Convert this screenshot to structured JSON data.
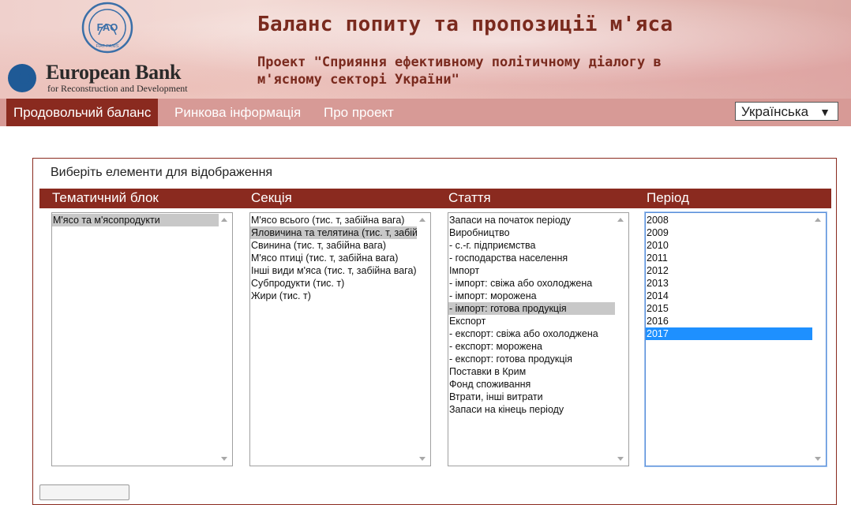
{
  "header": {
    "fao_logo_text": "FAO",
    "fao_motto": "FIAT PANIS",
    "ebrd_name": "European Bank",
    "ebrd_subtitle": "for Reconstruction and Development",
    "title": "Баланс попиту та пропозиції м'яса",
    "subtitle": "Проект \"Сприяння ефективному політичному діалогу в м'ясному секторі України\""
  },
  "nav": {
    "items": [
      {
        "label": "Продовольчий баланс",
        "active": true
      },
      {
        "label": "Ринкова інформація",
        "active": false
      },
      {
        "label": "Про проект",
        "active": false
      }
    ],
    "language": {
      "selected": "Українська",
      "arrow": "▼"
    }
  },
  "panel": {
    "title": "Виберіть елементи для відображення",
    "columns": [
      {
        "header": "Тематичний блок",
        "options": [
          {
            "label": "М'ясо та м'ясопродукти",
            "state": "gray"
          }
        ]
      },
      {
        "header": "Секція",
        "options": [
          {
            "label": "М'ясо всього (тис. т, забійна вага)",
            "state": "none"
          },
          {
            "label": "Яловичина та телятина (тис. т, забійна вага)",
            "state": "gray"
          },
          {
            "label": "Свинина (тис. т, забійна вага)",
            "state": "none"
          },
          {
            "label": "М'ясо птиці (тис. т, забійна вага)",
            "state": "none"
          },
          {
            "label": "Інші види м'яса (тис. т, забійна вага)",
            "state": "none"
          },
          {
            "label": "Субпродукти (тис. т)",
            "state": "none"
          },
          {
            "label": "Жири (тис. т)",
            "state": "none"
          }
        ]
      },
      {
        "header": "Стаття",
        "options": [
          {
            "label": "Запаси на початок періоду",
            "state": "none"
          },
          {
            "label": "Виробництво",
            "state": "none"
          },
          {
            "label": "- с.-г. підприємства",
            "state": "none"
          },
          {
            "label": "- господарства населення",
            "state": "none"
          },
          {
            "label": "Імпорт",
            "state": "none"
          },
          {
            "label": "- імпорт: свіжа або охолоджена",
            "state": "none"
          },
          {
            "label": "- імпорт: морожена",
            "state": "none"
          },
          {
            "label": "- імпорт: готова продукція",
            "state": "gray"
          },
          {
            "label": "Експорт",
            "state": "none"
          },
          {
            "label": "- експорт: свіжа або охолоджена",
            "state": "none"
          },
          {
            "label": "- експорт: морожена",
            "state": "none"
          },
          {
            "label": "- експорт: готова продукція",
            "state": "none"
          },
          {
            "label": "Поставки в Крим",
            "state": "none"
          },
          {
            "label": "Фонд споживання",
            "state": "none"
          },
          {
            "label": "Втрати, інші витрати",
            "state": "none"
          },
          {
            "label": "Запаси на кінець періоду",
            "state": "none"
          }
        ]
      },
      {
        "header": "Період",
        "focused": true,
        "options": [
          {
            "label": "2008",
            "state": "none"
          },
          {
            "label": "2009",
            "state": "none"
          },
          {
            "label": "2010",
            "state": "none"
          },
          {
            "label": "2011",
            "state": "none"
          },
          {
            "label": "2012",
            "state": "none"
          },
          {
            "label": "2013",
            "state": "none"
          },
          {
            "label": "2014",
            "state": "none"
          },
          {
            "label": "2015",
            "state": "none"
          },
          {
            "label": "2016",
            "state": "none"
          },
          {
            "label": "2017",
            "state": "blue"
          }
        ]
      }
    ]
  },
  "colors": {
    "brand_dark": "#8a2a1f",
    "nav_bg": "#d79a96",
    "title_color": "#7a2a1e",
    "selected_blue": "#1e90ff",
    "selected_gray": "#c8c8c8"
  }
}
